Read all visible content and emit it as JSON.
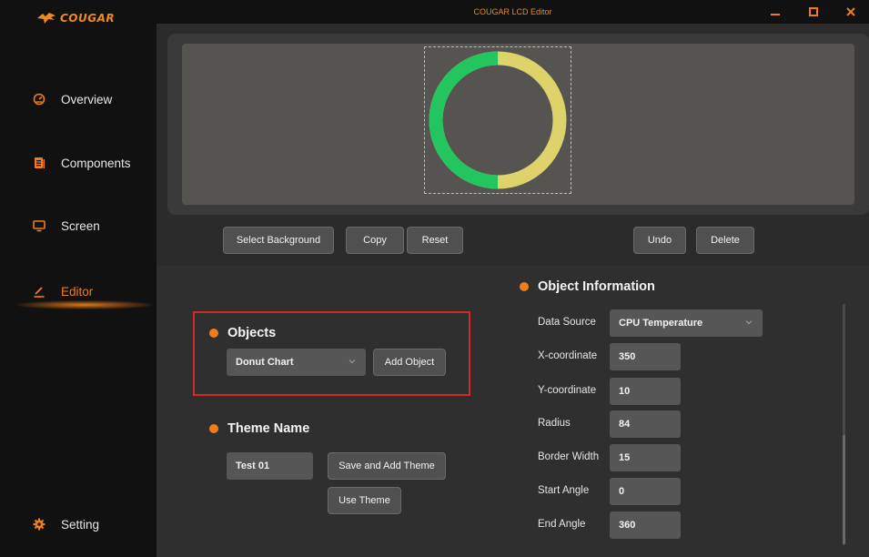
{
  "window": {
    "title": "COUGAR LCD Editor"
  },
  "brand": {
    "logo_text": "COUGAR",
    "accent": "#f07d1a"
  },
  "sidebar": {
    "items": [
      {
        "label": "Overview",
        "icon": "gauge-icon"
      },
      {
        "label": "Components",
        "icon": "document-icon"
      },
      {
        "label": "Screen",
        "icon": "monitor-icon"
      },
      {
        "label": "Editor",
        "icon": "pencil-icon",
        "active": true
      },
      {
        "label": "Setting",
        "icon": "gear-icon"
      }
    ]
  },
  "preview": {
    "donut": {
      "green_color": "#22c55e",
      "yellow_color": "#ddd36a",
      "green_fraction": 0.5
    }
  },
  "toolbar": {
    "select_background": "Select Background",
    "copy": "Copy",
    "reset": "Reset",
    "undo": "Undo",
    "delete": "Delete"
  },
  "objects": {
    "title": "Objects",
    "selected": "Donut Chart",
    "add_label": "Add Object"
  },
  "theme": {
    "title": "Theme Name",
    "value": "Test 01",
    "save_label": "Save and Add Theme",
    "use_label": "Use Theme"
  },
  "object_info": {
    "title": "Object Information",
    "data_source_label": "Data Source",
    "data_source_value": "CPU Temperature",
    "fields": [
      {
        "label": "X-coordinate",
        "value": "350"
      },
      {
        "label": "Y-coordinate",
        "value": "10"
      },
      {
        "label": "Radius",
        "value": "84"
      },
      {
        "label": "Border Width",
        "value": "15"
      },
      {
        "label": "Start Angle",
        "value": "0"
      },
      {
        "label": "End Angle",
        "value": "360"
      }
    ]
  }
}
